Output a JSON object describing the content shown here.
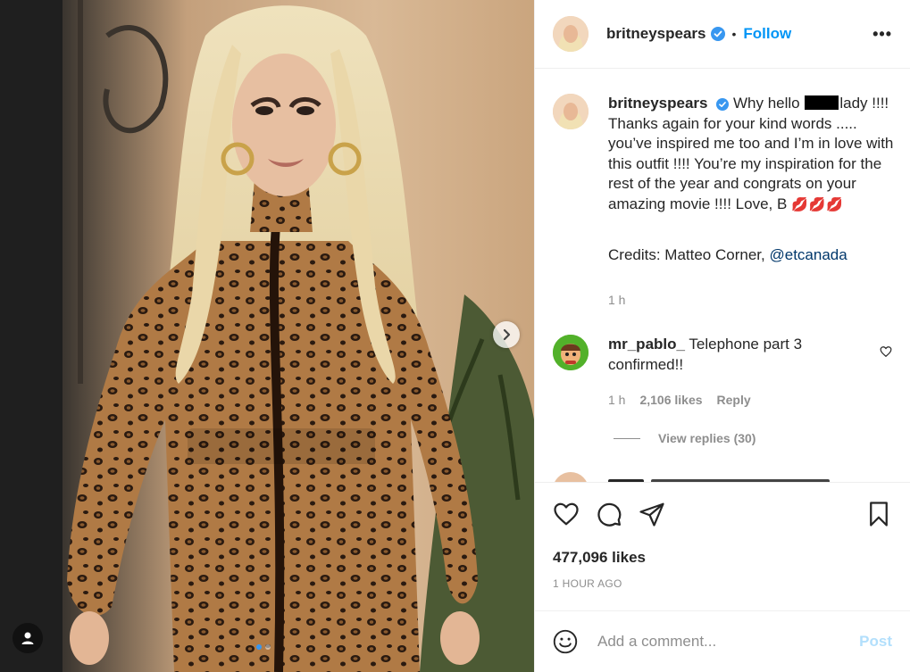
{
  "post": {
    "username": "britneyspears",
    "follow_label": "Follow",
    "more_label": "•••",
    "separator": "•"
  },
  "caption": {
    "username": "britneyspears",
    "text_before_redaction": "Why hello",
    "text_after_redaction": "lady !!!! Thanks again for your kind words ..... you’ve inspired me too and I’m in love with this outfit !!!! You’re my inspiration for the rest of the year and congrats on your amazing movie !!!! Love, B",
    "emoji": "💋💋💋",
    "credits_label": "Credits: Matteo Corner,",
    "credits_mention": "@etcanada",
    "time": "1 h"
  },
  "comment": {
    "username": "mr_pablo_",
    "text": "Telephone part 3 confirmed!!",
    "time": "1 h",
    "likes": "2,106 likes",
    "reply_label": "Reply",
    "view_replies": "View replies (30)"
  },
  "actions": {
    "like_icon": "heart-icon",
    "comment_icon": "comment-icon",
    "share_icon": "paper-plane-icon",
    "save_icon": "bookmark-icon",
    "likes_count": "477,096 likes",
    "posted_ago": "1 HOUR AGO"
  },
  "add_comment": {
    "placeholder": "Add a comment...",
    "post_label": "Post"
  },
  "carousel": {
    "total_slides": 2,
    "current_slide": 1
  },
  "colors": {
    "accent": "#0095f6",
    "verified": "#3897f0",
    "post_disabled": "#b2dffc"
  }
}
